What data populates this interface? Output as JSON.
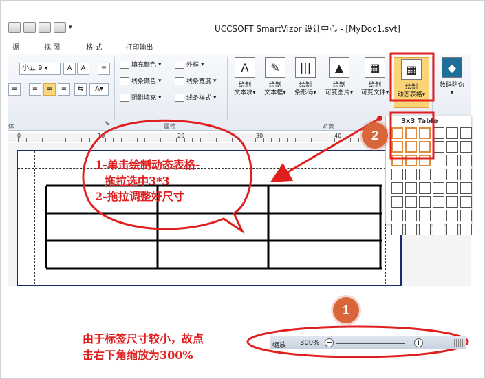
{
  "window": {
    "title": "UCCSOFT SmartVizor 设计中心 - [MyDoc1.svt]"
  },
  "tabs": [
    "据",
    "视 图",
    "格 式",
    "打印输出"
  ],
  "ribbon": {
    "font_size": "小五 9",
    "fill_color": "填充颜色",
    "line_color": "线条颜色",
    "shadow_fill": "阴影填充",
    "border": "外框",
    "line_width": "线条宽度",
    "line_style": "线条样式",
    "group_attr": "属性",
    "group_object": "对象",
    "group_font_tail": "体",
    "btn_textblock": [
      "绘制",
      "文本块"
    ],
    "btn_textbox": [
      "绘制",
      "文本框"
    ],
    "btn_barcode": [
      "绘制",
      "条形码"
    ],
    "btn_varimage": [
      "绘制",
      "可变图片"
    ],
    "btn_varfile": [
      "绘制",
      "可变文件"
    ],
    "btn_dyntable": [
      "绘制",
      "动态表格"
    ],
    "btn_anticounterfeit": "数码防伪"
  },
  "popup": {
    "title": "3x3 Table",
    "rows": 8,
    "cols": 6,
    "selected_rows": 3,
    "selected_cols": 3
  },
  "ruler": {
    "labels": [
      "0",
      "10",
      "20",
      "30",
      "40"
    ]
  },
  "statusbar": {
    "zoom_label": "缩放",
    "zoom_value": "300%",
    "minus": "−",
    "plus": "+"
  },
  "annotations": {
    "bubble_line1": "1-单击绘制动态表格-",
    "bubble_line2": "拖拉选中3*3",
    "bubble_line3": "2-拖拉调整好尺寸",
    "bottom_line1": "由于标签尺寸较小，故点",
    "bottom_line2": "击右下角缩放为300%",
    "badge1": "1",
    "badge2": "2"
  },
  "colors": {
    "annotation_red": "#e02020",
    "badge_orange": "#d9653b",
    "selection_orange": "#e48a3c",
    "page_border_navy": "#1a2a6a"
  }
}
